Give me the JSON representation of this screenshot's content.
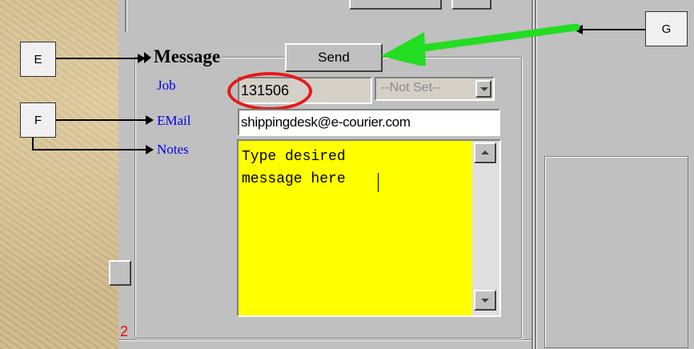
{
  "message_section": {
    "title": "Message",
    "send_button": "Send",
    "job": {
      "label": "Job",
      "value": "131506",
      "dropdown_value": "--Not Set--"
    },
    "email": {
      "label": "EMail",
      "value": "shippingdesk@e-courier.com"
    },
    "notes": {
      "label": "Notes",
      "value": "Type desired\nmessage here",
      "background_color": "#ffff00"
    }
  },
  "status_text": "2",
  "callouts": {
    "e": "E",
    "f": "F",
    "g": "G"
  },
  "colors": {
    "label_blue": "#0000e6",
    "highlight_red": "#e61919",
    "arrow_green": "#22dd22",
    "panel_gray": "#c0c0c0"
  },
  "icons": {
    "dropdown": "chevron-down-icon",
    "scroll_up": "scroll-up-arrow-icon",
    "scroll_down": "scroll-down-arrow-icon"
  }
}
